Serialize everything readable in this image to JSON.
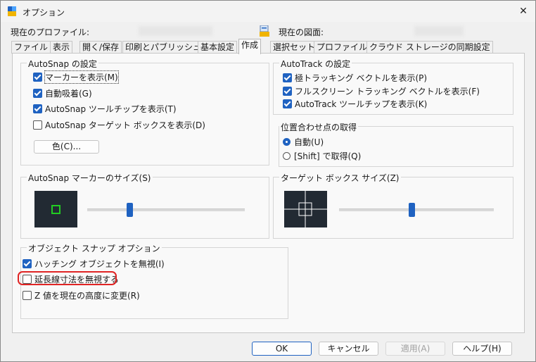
{
  "window": {
    "title": "オプション",
    "close_glyph": "✕"
  },
  "header": {
    "profile_label": "現在のプロファイル:",
    "drawing_label": "現在の図面:"
  },
  "tabs": [
    {
      "label": "ファイル"
    },
    {
      "label": "表示"
    },
    {
      "label": "開く/保存"
    },
    {
      "label": "印刷とパブリッシュ"
    },
    {
      "label": "基本設定"
    },
    {
      "label": "作成",
      "active": true
    },
    {
      "label": "選択セット"
    },
    {
      "label": "プロファイル"
    },
    {
      "label": "クラウド ストレージの同期設定"
    }
  ],
  "autosnap": {
    "title": "AutoSnap の設定",
    "items": [
      {
        "label": "マーカーを表示(M)",
        "checked": true
      },
      {
        "label": "自動吸着(G)",
        "checked": true
      },
      {
        "label": "AutoSnap ツールチップを表示(T)",
        "checked": true
      },
      {
        "label": "AutoSnap ターゲット ボックスを表示(D)",
        "checked": false
      }
    ],
    "color_button": "色(C)..."
  },
  "autotrack": {
    "title": "AutoTrack の設定",
    "items": [
      {
        "label": "極トラッキング ベクトルを表示(P)",
        "checked": true
      },
      {
        "label": "フルスクリーン トラッキング ベクトルを表示(F)",
        "checked": true
      },
      {
        "label": "AutoTrack ツールチップを表示(K)",
        "checked": true
      }
    ]
  },
  "alignment": {
    "title": "位置合わせ点の取得",
    "options": [
      {
        "label": "自動(U)",
        "selected": true
      },
      {
        "label": "[Shift] で取得(Q)",
        "selected": false
      }
    ]
  },
  "marker_size": {
    "title": "AutoSnap マーカーのサイズ(S)",
    "slider_fraction": 0.27
  },
  "target_box": {
    "title": "ターゲット ボックス サイズ(Z)",
    "slider_fraction": 0.47
  },
  "osnap": {
    "title": "オブジェクト スナップ オプション",
    "items": [
      {
        "label": "ハッチング オブジェクトを無視(I)",
        "checked": true
      },
      {
        "label": "延長線寸法を無視する",
        "checked": false
      },
      {
        "label": "Z 値を現在の高度に変更(R)",
        "checked": false
      }
    ]
  },
  "buttons": {
    "ok": "OK",
    "cancel": "キャンセル",
    "apply": "適用(A)",
    "help": "ヘルプ(H)"
  },
  "colors": {
    "accent": "#1f62c1",
    "preview_bg": "#222a33",
    "marker": "#22cc22",
    "highlight": "#e02424"
  }
}
